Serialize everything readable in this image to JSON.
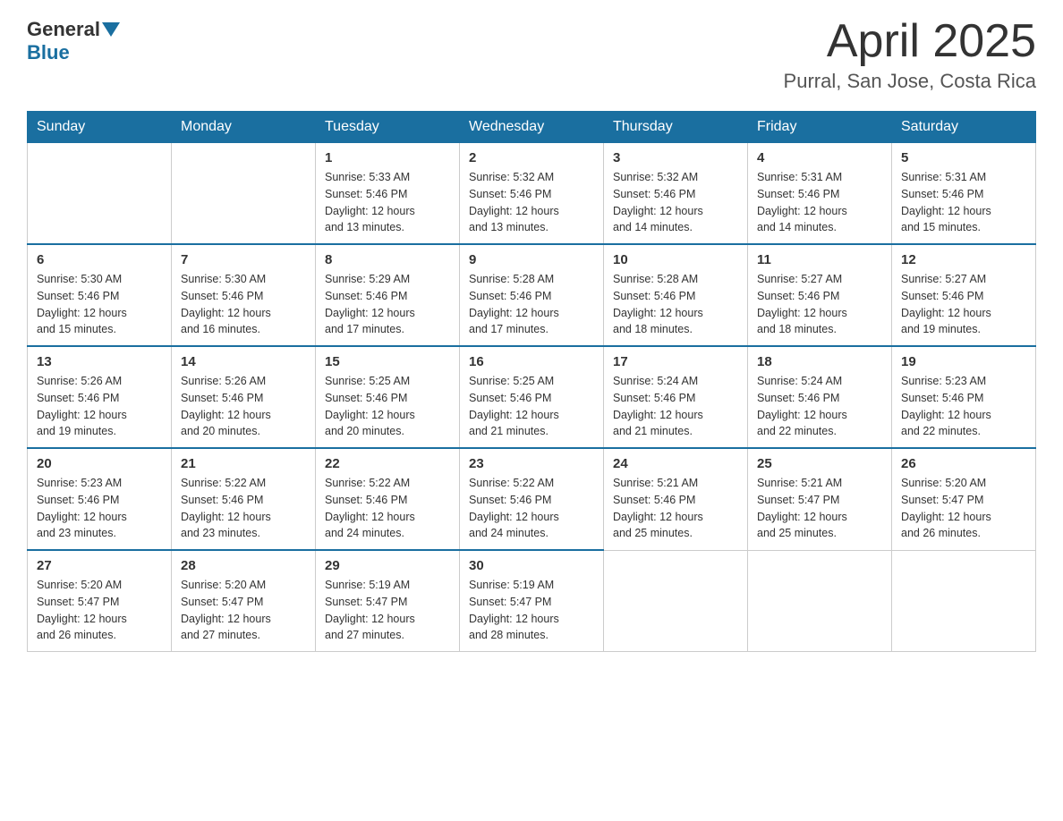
{
  "header": {
    "logo_general": "General",
    "logo_blue": "Blue",
    "month_title": "April 2025",
    "location": "Purral, San Jose, Costa Rica"
  },
  "days_of_week": [
    "Sunday",
    "Monday",
    "Tuesday",
    "Wednesday",
    "Thursday",
    "Friday",
    "Saturday"
  ],
  "weeks": [
    [
      {
        "day": "",
        "info": ""
      },
      {
        "day": "",
        "info": ""
      },
      {
        "day": "1",
        "info": "Sunrise: 5:33 AM\nSunset: 5:46 PM\nDaylight: 12 hours\nand 13 minutes."
      },
      {
        "day": "2",
        "info": "Sunrise: 5:32 AM\nSunset: 5:46 PM\nDaylight: 12 hours\nand 13 minutes."
      },
      {
        "day": "3",
        "info": "Sunrise: 5:32 AM\nSunset: 5:46 PM\nDaylight: 12 hours\nand 14 minutes."
      },
      {
        "day": "4",
        "info": "Sunrise: 5:31 AM\nSunset: 5:46 PM\nDaylight: 12 hours\nand 14 minutes."
      },
      {
        "day": "5",
        "info": "Sunrise: 5:31 AM\nSunset: 5:46 PM\nDaylight: 12 hours\nand 15 minutes."
      }
    ],
    [
      {
        "day": "6",
        "info": "Sunrise: 5:30 AM\nSunset: 5:46 PM\nDaylight: 12 hours\nand 15 minutes."
      },
      {
        "day": "7",
        "info": "Sunrise: 5:30 AM\nSunset: 5:46 PM\nDaylight: 12 hours\nand 16 minutes."
      },
      {
        "day": "8",
        "info": "Sunrise: 5:29 AM\nSunset: 5:46 PM\nDaylight: 12 hours\nand 17 minutes."
      },
      {
        "day": "9",
        "info": "Sunrise: 5:28 AM\nSunset: 5:46 PM\nDaylight: 12 hours\nand 17 minutes."
      },
      {
        "day": "10",
        "info": "Sunrise: 5:28 AM\nSunset: 5:46 PM\nDaylight: 12 hours\nand 18 minutes."
      },
      {
        "day": "11",
        "info": "Sunrise: 5:27 AM\nSunset: 5:46 PM\nDaylight: 12 hours\nand 18 minutes."
      },
      {
        "day": "12",
        "info": "Sunrise: 5:27 AM\nSunset: 5:46 PM\nDaylight: 12 hours\nand 19 minutes."
      }
    ],
    [
      {
        "day": "13",
        "info": "Sunrise: 5:26 AM\nSunset: 5:46 PM\nDaylight: 12 hours\nand 19 minutes."
      },
      {
        "day": "14",
        "info": "Sunrise: 5:26 AM\nSunset: 5:46 PM\nDaylight: 12 hours\nand 20 minutes."
      },
      {
        "day": "15",
        "info": "Sunrise: 5:25 AM\nSunset: 5:46 PM\nDaylight: 12 hours\nand 20 minutes."
      },
      {
        "day": "16",
        "info": "Sunrise: 5:25 AM\nSunset: 5:46 PM\nDaylight: 12 hours\nand 21 minutes."
      },
      {
        "day": "17",
        "info": "Sunrise: 5:24 AM\nSunset: 5:46 PM\nDaylight: 12 hours\nand 21 minutes."
      },
      {
        "day": "18",
        "info": "Sunrise: 5:24 AM\nSunset: 5:46 PM\nDaylight: 12 hours\nand 22 minutes."
      },
      {
        "day": "19",
        "info": "Sunrise: 5:23 AM\nSunset: 5:46 PM\nDaylight: 12 hours\nand 22 minutes."
      }
    ],
    [
      {
        "day": "20",
        "info": "Sunrise: 5:23 AM\nSunset: 5:46 PM\nDaylight: 12 hours\nand 23 minutes."
      },
      {
        "day": "21",
        "info": "Sunrise: 5:22 AM\nSunset: 5:46 PM\nDaylight: 12 hours\nand 23 minutes."
      },
      {
        "day": "22",
        "info": "Sunrise: 5:22 AM\nSunset: 5:46 PM\nDaylight: 12 hours\nand 24 minutes."
      },
      {
        "day": "23",
        "info": "Sunrise: 5:22 AM\nSunset: 5:46 PM\nDaylight: 12 hours\nand 24 minutes."
      },
      {
        "day": "24",
        "info": "Sunrise: 5:21 AM\nSunset: 5:46 PM\nDaylight: 12 hours\nand 25 minutes."
      },
      {
        "day": "25",
        "info": "Sunrise: 5:21 AM\nSunset: 5:47 PM\nDaylight: 12 hours\nand 25 minutes."
      },
      {
        "day": "26",
        "info": "Sunrise: 5:20 AM\nSunset: 5:47 PM\nDaylight: 12 hours\nand 26 minutes."
      }
    ],
    [
      {
        "day": "27",
        "info": "Sunrise: 5:20 AM\nSunset: 5:47 PM\nDaylight: 12 hours\nand 26 minutes."
      },
      {
        "day": "28",
        "info": "Sunrise: 5:20 AM\nSunset: 5:47 PM\nDaylight: 12 hours\nand 27 minutes."
      },
      {
        "day": "29",
        "info": "Sunrise: 5:19 AM\nSunset: 5:47 PM\nDaylight: 12 hours\nand 27 minutes."
      },
      {
        "day": "30",
        "info": "Sunrise: 5:19 AM\nSunset: 5:47 PM\nDaylight: 12 hours\nand 28 minutes."
      },
      {
        "day": "",
        "info": ""
      },
      {
        "day": "",
        "info": ""
      },
      {
        "day": "",
        "info": ""
      }
    ]
  ]
}
